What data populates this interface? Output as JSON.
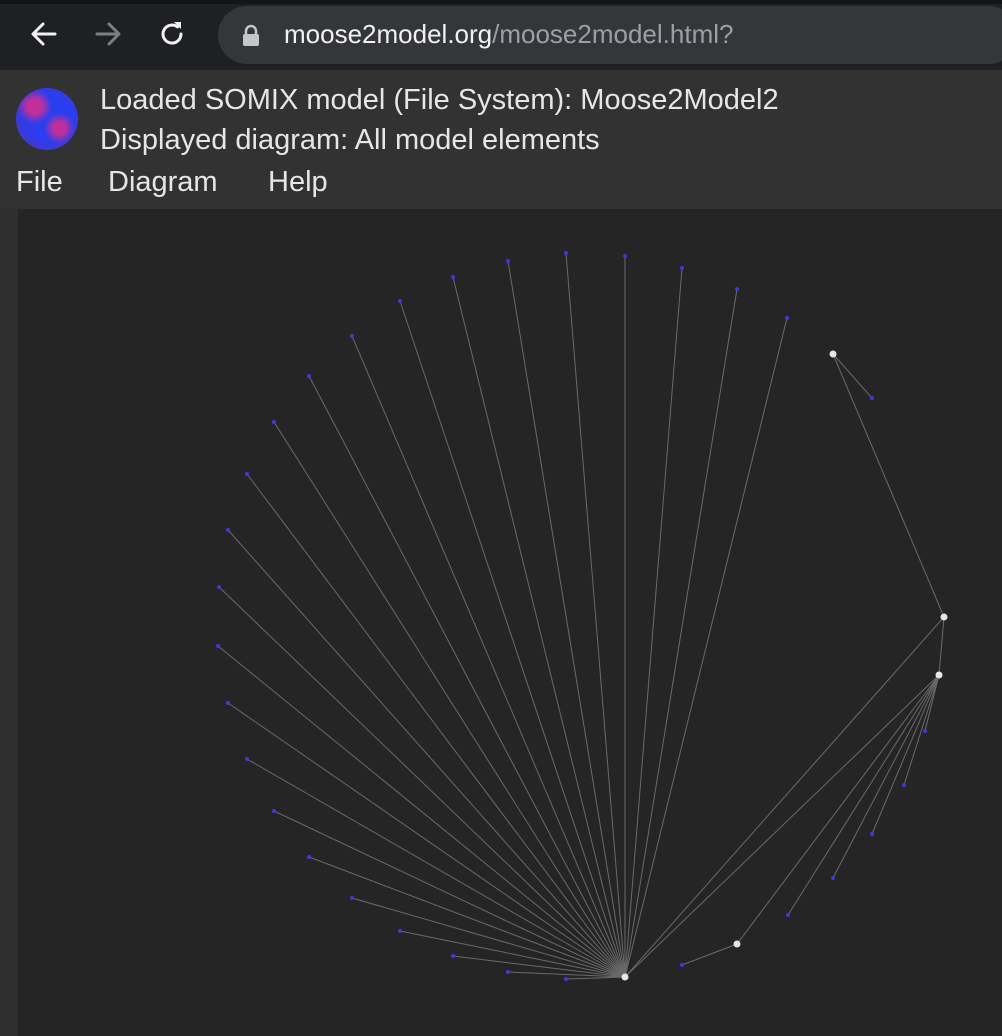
{
  "browser": {
    "url_host": "moose2model.org",
    "url_path": "/moose2model.html?"
  },
  "header": {
    "loaded_model": "Loaded SOMIX model (File System): Moose2Model2",
    "displayed_diagram": "Displayed diagram: All model elements"
  },
  "menu": {
    "items": [
      {
        "label": "File"
      },
      {
        "label": "Diagram"
      },
      {
        "label": "Help"
      }
    ]
  },
  "colors": {
    "canvas_bg": "#252525",
    "edge": "#6a6a6a",
    "node_leaf": "#3a3ae0",
    "node_hub": "#e6e6e6"
  }
}
